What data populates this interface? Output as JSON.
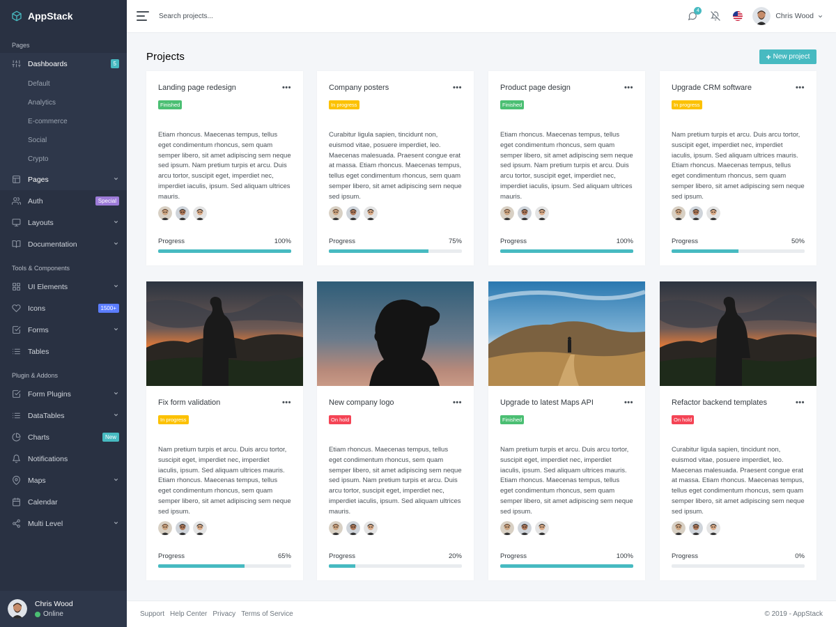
{
  "brand": {
    "name": "AppStack"
  },
  "colors": {
    "accent": "#47bac1",
    "finished": "#4bbf73",
    "in_progress": "#fcc100",
    "on_hold": "#f44455",
    "sidebar_bg": "#293142"
  },
  "sidebar": {
    "headers": [
      "Pages",
      "Tools & Components",
      "Plugin & Addons"
    ],
    "dashboards": {
      "label": "Dashboards",
      "badge": "5",
      "icon": "sliders-icon"
    },
    "dashboard_subitems": [
      "Default",
      "Analytics",
      "E-commerce",
      "Social",
      "Crypto"
    ],
    "pages_group": [
      {
        "label": "Pages",
        "icon": "layout-icon",
        "chevron": true,
        "badge": ""
      },
      {
        "label": "Auth",
        "icon": "users-icon",
        "chevron": false,
        "badge": "Special"
      },
      {
        "label": "Layouts",
        "icon": "monitor-icon",
        "chevron": true,
        "badge": ""
      },
      {
        "label": "Documentation",
        "icon": "book-icon",
        "chevron": true,
        "badge": ""
      }
    ],
    "tools_group": [
      {
        "label": "UI Elements",
        "icon": "grid-icon",
        "chevron": true,
        "badge": ""
      },
      {
        "label": "Icons",
        "icon": "heart-icon",
        "chevron": false,
        "badge": "1500+"
      },
      {
        "label": "Forms",
        "icon": "check-square-icon",
        "chevron": true,
        "badge": ""
      },
      {
        "label": "Tables",
        "icon": "list-icon",
        "chevron": false,
        "badge": ""
      }
    ],
    "plugins_group": [
      {
        "label": "Form Plugins",
        "icon": "check-square-icon",
        "chevron": true,
        "badge": ""
      },
      {
        "label": "DataTables",
        "icon": "list-icon",
        "chevron": true,
        "badge": ""
      },
      {
        "label": "Charts",
        "icon": "pie-chart-icon",
        "chevron": false,
        "badge": "New"
      },
      {
        "label": "Notifications",
        "icon": "bell-icon",
        "chevron": false,
        "badge": ""
      },
      {
        "label": "Maps",
        "icon": "map-pin-icon",
        "chevron": true,
        "badge": ""
      },
      {
        "label": "Calendar",
        "icon": "calendar-icon",
        "chevron": false,
        "badge": ""
      },
      {
        "label": "Multi Level",
        "icon": "share-icon",
        "chevron": true,
        "badge": ""
      }
    ],
    "user": {
      "name": "Chris Wood",
      "status": "Online"
    }
  },
  "topbar": {
    "search_placeholder": "Search projects...",
    "messages_count": "4",
    "user_name": "Chris Wood"
  },
  "main": {
    "title": "Projects",
    "new_project_label": "New project",
    "progress_label": "Progress",
    "cards": [
      {
        "title": "Landing page redesign",
        "status": "Finished",
        "status_type": "finished",
        "progress": 100,
        "progress_text": "100%",
        "has_image": false,
        "desc": "Etiam rhoncus. Maecenas tempus, tellus eget condimentum rhoncus, sem quam semper libero, sit amet adipiscing sem neque sed ipsum. Nam pretium turpis et arcu. Duis arcu tortor, suscipit eget, imperdiet nec, imperdiet iaculis, ipsum. Sed aliquam ultrices mauris."
      },
      {
        "title": "Company posters",
        "status": "In progress",
        "status_type": "in_progress",
        "progress": 75,
        "progress_text": "75%",
        "has_image": false,
        "desc": "Curabitur ligula sapien, tincidunt non, euismod vitae, posuere imperdiet, leo. Maecenas malesuada. Praesent congue erat at massa. Etiam rhoncus. Maecenas tempus, tellus eget condimentum rhoncus, sem quam semper libero, sit amet adipiscing sem neque sed ipsum."
      },
      {
        "title": "Product page design",
        "status": "Finished",
        "status_type": "finished",
        "progress": 100,
        "progress_text": "100%",
        "has_image": false,
        "desc": "Etiam rhoncus. Maecenas tempus, tellus eget condimentum rhoncus, sem quam semper libero, sit amet adipiscing sem neque sed ipsum. Nam pretium turpis et arcu. Duis arcu tortor, suscipit eget, imperdiet nec, imperdiet iaculis, ipsum. Sed aliquam ultrices mauris."
      },
      {
        "title": "Upgrade CRM software",
        "status": "In progress",
        "status_type": "in_progress",
        "progress": 50,
        "progress_text": "50%",
        "has_image": false,
        "desc": "Nam pretium turpis et arcu. Duis arcu tortor, suscipit eget, imperdiet nec, imperdiet iaculis, ipsum. Sed aliquam ultrices mauris. Etiam rhoncus. Maecenas tempus, tellus eget condimentum rhoncus, sem quam semper libero, sit amet adipiscing sem neque sed ipsum."
      },
      {
        "title": "Fix form validation",
        "status": "In progress",
        "status_type": "in_progress",
        "progress": 65,
        "progress_text": "65%",
        "has_image": true,
        "image": "sunset-hiker-photo",
        "desc": "Nam pretium turpis et arcu. Duis arcu tortor, suscipit eget, imperdiet nec, imperdiet iaculis, ipsum. Sed aliquam ultrices mauris. Etiam rhoncus. Maecenas tempus, tellus eget condimentum rhoncus, sem quam semper libero, sit amet adipiscing sem neque sed ipsum."
      },
      {
        "title": "New company logo",
        "status": "On hold",
        "status_type": "on_hold",
        "progress": 20,
        "progress_text": "20%",
        "has_image": true,
        "image": "silhouette-woman-photo",
        "desc": "Etiam rhoncus. Maecenas tempus, tellus eget condimentum rhoncus, sem quam semper libero, sit amet adipiscing sem neque sed ipsum. Nam pretium turpis et arcu. Duis arcu tortor, suscipit eget, imperdiet nec, imperdiet iaculis, ipsum. Sed aliquam ultrices mauris."
      },
      {
        "title": "Upgrade to latest Maps API",
        "status": "Finished",
        "status_type": "finished",
        "progress": 100,
        "progress_text": "100%",
        "has_image": true,
        "image": "hills-walker-photo",
        "desc": "Nam pretium turpis et arcu. Duis arcu tortor, suscipit eget, imperdiet nec, imperdiet iaculis, ipsum. Sed aliquam ultrices mauris. Etiam rhoncus. Maecenas tempus, tellus eget condimentum rhoncus, sem quam semper libero, sit amet adipiscing sem neque sed ipsum."
      },
      {
        "title": "Refactor backend templates",
        "status": "On hold",
        "status_type": "on_hold",
        "progress": 0,
        "progress_text": "0%",
        "has_image": true,
        "image": "sunset-hiker-photo",
        "desc": "Curabitur ligula sapien, tincidunt non, euismod vitae, posuere imperdiet, leo. Maecenas malesuada. Praesent congue erat at massa. Etiam rhoncus. Maecenas tempus, tellus eget condimentum rhoncus, sem quam semper libero, sit amet adipiscing sem neque sed ipsum."
      }
    ]
  },
  "footer": {
    "links": [
      "Support",
      "Help Center",
      "Privacy",
      "Terms of Service"
    ],
    "copyright": "© 2019 - AppStack"
  }
}
